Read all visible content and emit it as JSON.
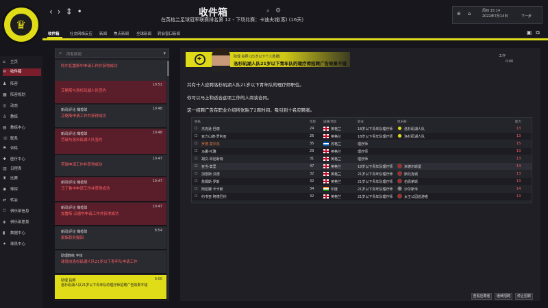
{
  "app": {
    "title": "收件箱",
    "subtitle": "在英格兰足球冠军联赛排名第 12 - 下场比赛：卡迪夫城(客) (16天)"
  },
  "date": {
    "day": "周四 15:14",
    "date": "2022年7月14日",
    "continue": "下一步"
  },
  "tabs": [
    "收件箱",
    "社交网络反应",
    "新闻",
    "焦点新闻",
    "全球新闻",
    "转会窗口新闻"
  ],
  "search": {
    "placeholder": "所有新闻"
  },
  "sidebar": [
    "主页",
    "收件箱",
    "阵容",
    "阵容规划",
    "动态",
    "教练",
    "教练中心",
    "联系",
    "训练",
    "医疗中心",
    "日程表",
    "比赛",
    "球探",
    "转会",
    "俱乐部信息",
    "俱乐部愿景",
    "数据中心",
    "球员中心"
  ],
  "messages": [
    {
      "sender": "",
      "title": "阿尔瓦雷斯中申请工作并获得成功",
      "time": ""
    },
    {
      "sender": "",
      "title": "艾略斯与洛杉矶湖人队签约",
      "time": "10:51"
    },
    {
      "sender": "新闻/评论 橄榄球",
      "title": "艾略斯申请工作并获得成功",
      "time": "10:48"
    },
    {
      "sender": "新闻/评论 橄榄球",
      "title": "劳瑞与洛杉矶湖人队签约",
      "time": "10:48"
    },
    {
      "sender": "",
      "title": "劳瑞申请工作并获得成功",
      "time": "10:47"
    },
    {
      "sender": "新闻/评论 橄榄球",
      "title": "马丁鲁中申请工作并获得成功",
      "time": "10:47"
    },
    {
      "sender": "新闻/评论 橄榄球",
      "title": "加雷斯·汉德中申请工作并获得成功",
      "time": "10:47"
    },
    {
      "sender": "新闻/评论 橄榄球",
      "title": "家族职务撤回",
      "time": "8:54"
    },
    {
      "sender": "助理教练 字体",
      "title": "球员向洛杉矶湖人队21岁以下青年队申请工作",
      "time": ""
    },
    {
      "sender": "助理 拍照",
      "title": "洛杉矶湖人队21岁以下青年队的理疗师招聘广告效果不错",
      "time": "0:00"
    }
  ],
  "header": {
    "sender": "助理 拍照 (21岁以下个人数据)",
    "title": "洛杉矶湖人队21岁以下青年队的理疗师招聘广告效果不错",
    "work": "工作",
    "work_val": "0:00"
  },
  "body": {
    "p1": "共有十人应聘洛杉矶湖人队21岁以下青年队的理疗师职位。",
    "p2": "你可以马上和适合这项工作的人商谈合同。",
    "p3": "这一招聘广告在职业介绍所张贴了2周时间，吸引到十名应聘者。"
  },
  "table": {
    "headers": [
      "姓名",
      "年龄",
      "国籍/地区",
      "职业",
      "俱乐部",
      "能力"
    ],
    "rows": [
      {
        "name": "杰克逊·巴德",
        "age": "24",
        "nat": "英格兰",
        "job": "18岁以下青年队理疗师",
        "club": "洛杉矶湖人队",
        "rep": "13",
        "flag": "en",
        "ic": "y",
        "hl": false,
        "red": false
      },
      {
        "name": "亚力山德·罗利亚",
        "age": "26",
        "nat": "英格兰",
        "job": "18岁以下青年队理疗师",
        "club": "洛杉矶湖人队",
        "rep": "13",
        "flag": "en",
        "ic": "y",
        "hl": false,
        "red": false
      },
      {
        "name": "罗德·霍尔克",
        "age": "35",
        "nat": "苏格兰",
        "job": "理疗师",
        "club": "",
        "rep": "15",
        "flag": "sc",
        "ic": "",
        "hl": false,
        "red": true
      },
      {
        "name": "马娜·托雅",
        "age": "29",
        "nat": "英格兰",
        "job": "理疗师",
        "club": "",
        "rep": "13",
        "flag": "en",
        "ic": "",
        "hl": false,
        "red": false
      },
      {
        "name": "胡文·邓尼斯特",
        "age": "31",
        "nat": "英格兰",
        "job": "理疗师",
        "club": "",
        "rep": "13",
        "flag": "en",
        "ic": "",
        "hl": false,
        "red": false
      },
      {
        "name": "亚当·莫里",
        "age": "47",
        "nat": "英格兰",
        "job": "18岁以下青年队理疗师",
        "club": "米德尔斯堡",
        "rep": "14",
        "flag": "en",
        "ic": "r",
        "hl": true,
        "red": false
      },
      {
        "name": "加雷斯·汉德",
        "age": "32",
        "nat": "英格兰",
        "job": "21岁以下青年队理疗师",
        "club": "斯托克城",
        "rep": "13",
        "flag": "en",
        "ic": "r",
        "hl": false,
        "red": false
      },
      {
        "name": "詹姆斯·罗斯",
        "age": "32",
        "nat": "英格兰",
        "job": "21岁以下青年队理疗师",
        "club": "伯恩茅斯",
        "rep": "13",
        "flag": "en",
        "ic": "r",
        "hl": false,
        "red": false
      },
      {
        "name": "阿尼娜·卡卡斯",
        "age": "34",
        "nat": "印度",
        "job": "21岁以下青年队理疗师",
        "club": "沙尔斯韦",
        "rep": "14",
        "flag": "in",
        "ic": "g",
        "hl": false,
        "red": false
      },
      {
        "name": "约书亚·阿德巴约",
        "age": "32",
        "nat": "英格兰",
        "job": "21岁以下青年队理疗师",
        "club": "女王公园巡游者",
        "rep": "13",
        "flag": "en",
        "ic": "r",
        "hl": false,
        "red": false
      }
    ]
  },
  "buttons": [
    "查看应聘者",
    "继续招聘",
    "停止招聘"
  ]
}
